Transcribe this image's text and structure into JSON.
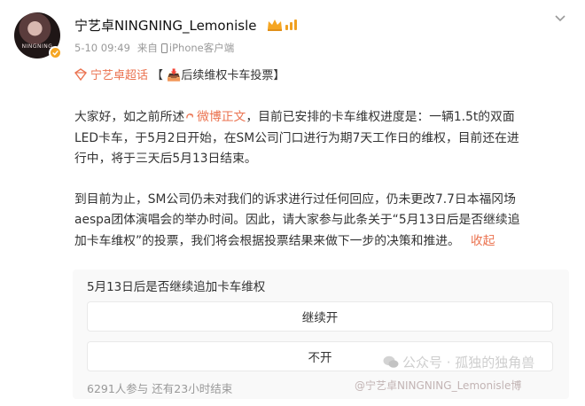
{
  "author": {
    "name": "宁艺卓NINGNING_Lemonisle",
    "avatar_text": "NINGNING",
    "time": "5-10 09:49",
    "via_label": "来自",
    "source": "iPhone客户端"
  },
  "topic": {
    "name": "宁艺卓超话",
    "rest": "【 📥后续维权卡车投票】"
  },
  "post": {
    "p1_l1_a": "大家好，如之前所述",
    "p1_link": "微博正文",
    "p1_l1_b": "，目前已安排的卡车维权进度是：一辆1.5t的双面",
    "p1_l2": "LED卡车，于5月2日开始，在SM公司门口进行为期7天工作日的维权，目前还在进",
    "p1_l3": "行中，将于三天后5月13日结束。",
    "p2_l1": "到目前为止，SM公司仍未对我们的诉求进行过任何回应，仍未更改7.7日本福冈场",
    "p2_l2": "aespa团体演唱会的举办时间。因此，请大家参与此条关于“5月13日后是否继续追",
    "p2_l3": "加卡车维权”的投票，我们将会根据投票结果来做下一步的决策和推进。",
    "collapse_label": "收起"
  },
  "poll": {
    "title": "5月13日后是否继续追加卡车维权",
    "options": [
      "继续开",
      "不开"
    ],
    "footer": "6291人参与 还有23小时结束"
  },
  "watermarks": {
    "weibo": "@宁艺卓NINGNING_Lemonisle博",
    "wechat": "公众号 · 孤独的独角兽"
  },
  "colors": {
    "accent": "#eb7350",
    "badge": "#f5a623",
    "muted": "#999999",
    "card_bg": "#f9f9f9"
  }
}
